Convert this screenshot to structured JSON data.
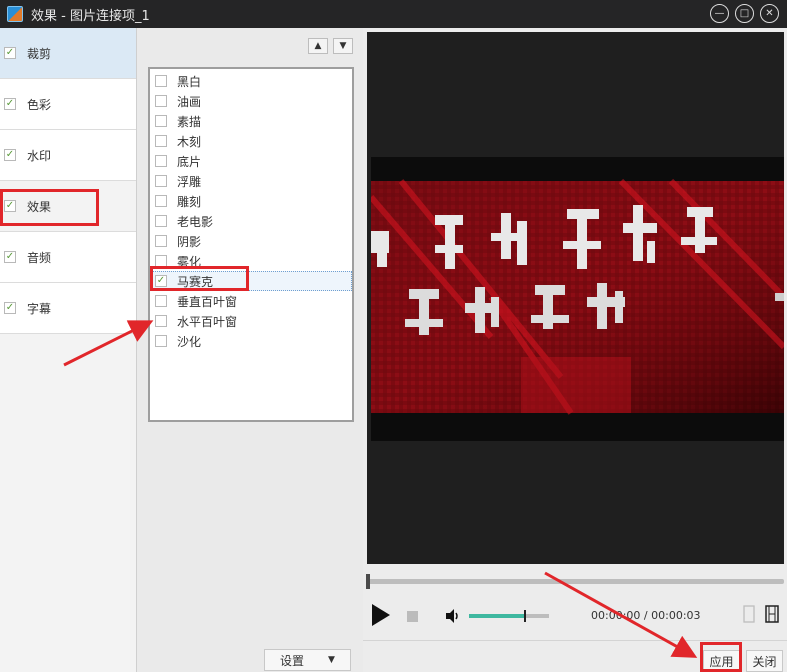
{
  "window": {
    "title": "效果 - 图片连接项_1"
  },
  "categories": [
    {
      "label": "裁剪",
      "checked": true,
      "active": true
    },
    {
      "label": "色彩",
      "checked": true,
      "active": false
    },
    {
      "label": "水印",
      "checked": true,
      "active": false
    },
    {
      "label": "效果",
      "checked": true,
      "active": false
    },
    {
      "label": "音频",
      "checked": true,
      "active": false
    },
    {
      "label": "字幕",
      "checked": true,
      "active": false
    }
  ],
  "effects": [
    {
      "label": "黑白",
      "checked": false
    },
    {
      "label": "油画",
      "checked": false
    },
    {
      "label": "素描",
      "checked": false
    },
    {
      "label": "木刻",
      "checked": false
    },
    {
      "label": "底片",
      "checked": false
    },
    {
      "label": "浮雕",
      "checked": false
    },
    {
      "label": "雕刻",
      "checked": false
    },
    {
      "label": "老电影",
      "checked": false
    },
    {
      "label": "阴影",
      "checked": false
    },
    {
      "label": "雾化",
      "checked": false
    },
    {
      "label": "马赛克",
      "checked": true
    },
    {
      "label": "垂直百叶窗",
      "checked": false
    },
    {
      "label": "水平百叶窗",
      "checked": false
    },
    {
      "label": "沙化",
      "checked": false
    }
  ],
  "settings_label": "设置",
  "player": {
    "current_time": "00:00:00",
    "separator": "/",
    "total_time": "00:00:03",
    "volume": 0.7,
    "progress": 0.0
  },
  "apply_label": "应用",
  "close_label": "关闭",
  "colors": {
    "titlebar": "#252526",
    "accent_volume": "#3fb8a0",
    "annotation": "#e1262a"
  }
}
